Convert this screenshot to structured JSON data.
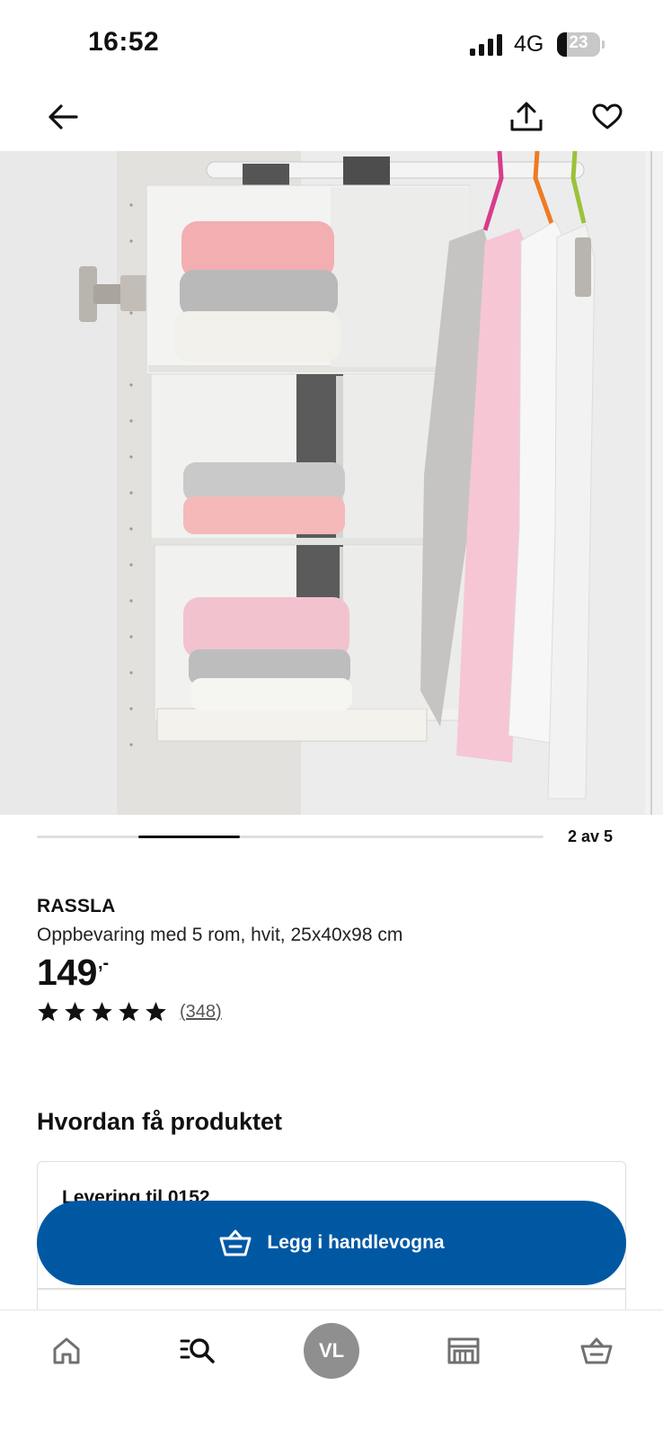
{
  "status_bar": {
    "time": "16:52",
    "network": "4G",
    "battery_level": "23",
    "battery_fraction": 0.23
  },
  "top_nav": {
    "icons": [
      "back-arrow-icon",
      "share-icon",
      "heart-icon"
    ]
  },
  "carousel": {
    "counter": "2 av 5",
    "current": 2,
    "total": 5
  },
  "product": {
    "name": "RASSLA",
    "description": "Oppbevaring med 5 rom, hvit, 25x40x98 cm",
    "price_integer": "149",
    "price_suffix": ",-",
    "rating": 5,
    "review_count": "(348)"
  },
  "availability": {
    "heading": "Hvordan få produktet",
    "delivery_title": "Levering til 0152"
  },
  "cta": {
    "label": "Legg i handlevogna",
    "color": "#0058a3"
  },
  "tab_bar": {
    "profile_initials": "VL",
    "icons": [
      "home-icon",
      "search-icon",
      "avatar",
      "store-icon",
      "cart-icon"
    ]
  }
}
